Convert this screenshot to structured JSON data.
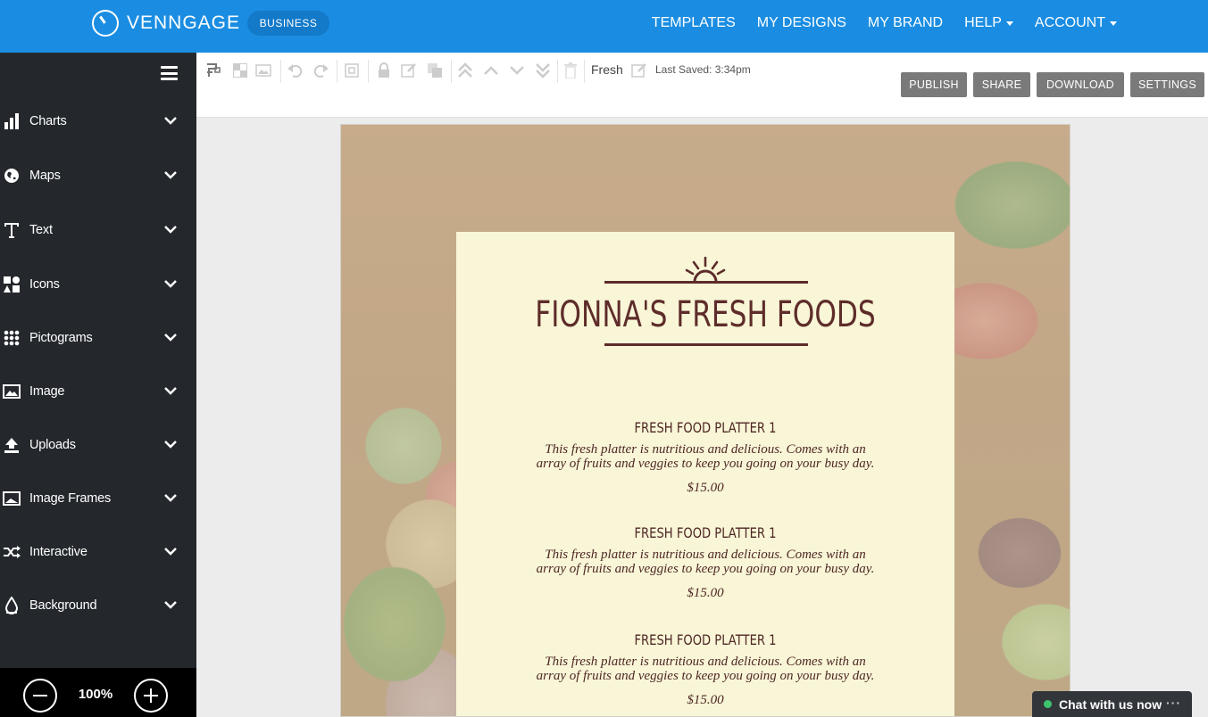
{
  "brand": {
    "name": "VENNGAGE",
    "plan": "BUSINESS"
  },
  "nav": [
    {
      "label": "TEMPLATES",
      "dropdown": false
    },
    {
      "label": "MY DESIGNS",
      "dropdown": false
    },
    {
      "label": "MY BRAND",
      "dropdown": false
    },
    {
      "label": "HELP",
      "dropdown": true
    },
    {
      "label": "ACCOUNT",
      "dropdown": true
    }
  ],
  "sidebar": {
    "items": [
      {
        "label": "Charts",
        "icon": "bar-chart-icon"
      },
      {
        "label": "Maps",
        "icon": "globe-icon"
      },
      {
        "label": "Text",
        "icon": "text-icon"
      },
      {
        "label": "Icons",
        "icon": "shapes-icon"
      },
      {
        "label": "Pictograms",
        "icon": "grid-dots-icon"
      },
      {
        "label": "Image",
        "icon": "image-icon"
      },
      {
        "label": "Uploads",
        "icon": "upload-icon"
      },
      {
        "label": "Image Frames",
        "icon": "frame-icon"
      },
      {
        "label": "Interactive",
        "icon": "shuffle-icon"
      },
      {
        "label": "Background",
        "icon": "drop-icon"
      }
    ]
  },
  "zoom": {
    "level": "100%"
  },
  "toolbar": {
    "design_name": "Fresh",
    "last_saved": "Last Saved: 3:34pm",
    "publish": "PUBLISH",
    "share": "SHARE",
    "download": "DOWNLOAD",
    "settings": "SETTINGS"
  },
  "menu": {
    "title": "FIONNA'S FRESH FOODS",
    "items": [
      {
        "name": "FRESH FOOD PLATTER 1",
        "desc_line1": "This fresh platter is nutritious and delicious.  Comes with an",
        "desc_line2": "array of fruits and veggies to keep you going on your busy day.",
        "price": "$15.00"
      },
      {
        "name": "FRESH FOOD PLATTER 1",
        "desc_line1": "This fresh platter is nutritious and delicious.  Comes with an",
        "desc_line2": "array of fruits and veggies to keep you going on your busy day.",
        "price": "$15.00"
      },
      {
        "name": "FRESH FOOD PLATTER 1",
        "desc_line1": "This fresh platter is nutritious and delicious.  Comes with an",
        "desc_line2": "array of fruits and veggies to keep you going on your busy day.",
        "price": "$15.00"
      }
    ]
  },
  "chat": {
    "label": "Chat with us now",
    "more": "···"
  },
  "colors": {
    "nav_bg": "#1a8de2",
    "sidebar_bg": "#24282d",
    "menu_text": "#5e2c2a",
    "card_bg": "#f8f6d7",
    "button_gray": "#7a7a7a"
  }
}
